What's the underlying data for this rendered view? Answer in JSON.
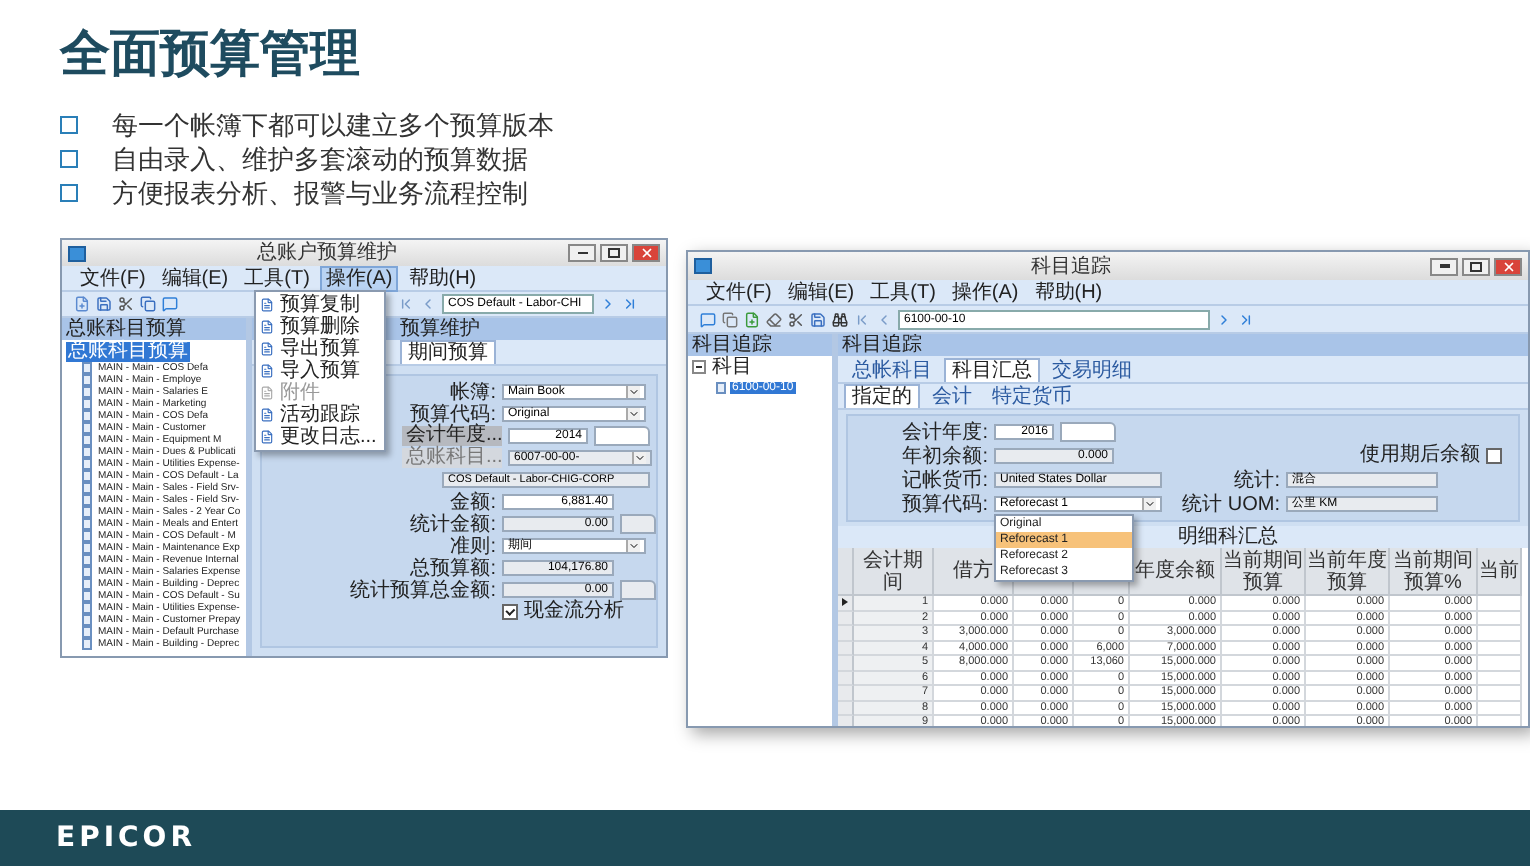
{
  "slide": {
    "title": "全面预算管理",
    "bullets": [
      "每一个帐簿下都可以建立多个预算版本",
      "自由录入、维护多套滚动的预算数据",
      "方便报表分析、报警与业务流程控制"
    ],
    "logo": "EPICOR"
  },
  "left_window": {
    "title": "总账户预算维护",
    "menu": [
      {
        "label": "文件(F)",
        "selected": false
      },
      {
        "label": "编辑(E)",
        "selected": false
      },
      {
        "label": "工具(T)",
        "selected": false
      },
      {
        "label": "操作(A)",
        "selected": true
      },
      {
        "label": "帮助(H)",
        "selected": false
      }
    ],
    "dropdown": [
      {
        "label": "预算复制",
        "disabled": false
      },
      {
        "label": "预算删除",
        "disabled": false
      },
      {
        "label": "导出预算",
        "disabled": false
      },
      {
        "label": "导入预算",
        "disabled": false
      },
      {
        "label": "附件",
        "disabled": true
      },
      {
        "label": "活动跟踪",
        "disabled": false
      },
      {
        "label": "更改日志...",
        "disabled": false
      }
    ],
    "nav_field": "COS Default - Labor-CHI",
    "tree_header": "总账科目预算",
    "tree": {
      "label": "总账科目预算",
      "selected": true,
      "children": [
        {
          "label": "MAIN - Main - COS Defa",
          "selected": false
        },
        {
          "label": "MAIN - Main - Employe",
          "selected": false
        },
        {
          "label": "MAIN - Main - Salaries E",
          "selected": false
        },
        {
          "label": "MAIN - Main - Marketing",
          "selected": false
        },
        {
          "label": "MAIN - Main - COS Defa",
          "selected": false
        },
        {
          "label": "MAIN - Main - Customer",
          "selected": false
        },
        {
          "label": "MAIN - Main - Equipment M",
          "selected": false
        },
        {
          "label": "MAIN - Main - Dues & Publicati",
          "selected": false
        },
        {
          "label": "MAIN - Main - Utilities Expense-",
          "selected": false
        },
        {
          "label": "MAIN - Main - COS Default - La",
          "selected": false
        },
        {
          "label": "MAIN - Main - Sales - Field Srv-",
          "selected": false
        },
        {
          "label": "MAIN - Main - Sales - Field Srv-",
          "selected": false
        },
        {
          "label": "MAIN - Main - Sales - 2 Year Co",
          "selected": false
        },
        {
          "label": "MAIN - Main - Meals and Entert",
          "selected": false
        },
        {
          "label": "MAIN - Main - COS Default - M",
          "selected": false
        },
        {
          "label": "MAIN - Main - Maintenance Exp",
          "selected": false
        },
        {
          "label": "MAIN - Main - Revenue Internal",
          "selected": false
        },
        {
          "label": "MAIN - Main - Salaries Expense",
          "selected": false
        },
        {
          "label": "MAIN - Main - Building - Deprec",
          "selected": false
        },
        {
          "label": "MAIN - Main - COS Default - Su",
          "selected": false
        },
        {
          "label": "MAIN - Main - Utilities Expense-",
          "selected": false
        },
        {
          "label": "MAIN - Main - Customer Prepay",
          "selected": false
        },
        {
          "label": "MAIN - Main - Default Purchase",
          "selected": false
        },
        {
          "label": "MAIN - Main - Building - Deprec",
          "selected": false
        }
      ]
    },
    "panel_header": "预算维护",
    "tabs": [
      {
        "label": "期间预算",
        "selected": true
      }
    ],
    "form": [
      {
        "kind": "select",
        "label": "帐簿:",
        "value": "Main Book"
      },
      {
        "kind": "select",
        "label": "预算代码:",
        "value": "Original"
      },
      {
        "kind": "button",
        "label": "会计年度...",
        "value": "2014"
      },
      {
        "kind": "account",
        "label": "总账科目...",
        "value": "6007-00-00-"
      },
      {
        "kind": "readonly",
        "value": "COS Default - Labor-CHIG-CORP"
      },
      {
        "kind": "input",
        "label": "金额:",
        "value": "6,881.40"
      },
      {
        "kind": "readonly_extra",
        "label": "统计金额:",
        "value": "0.00"
      },
      {
        "kind": "select",
        "label": "准则:",
        "value": "期间"
      },
      {
        "kind": "readonly",
        "label": "总预算额:",
        "value": "104,176.80"
      },
      {
        "kind": "readonly_extra",
        "label": "统计预算总金额:",
        "value": "0.00"
      },
      {
        "kind": "checkbox",
        "label": "现金流分析",
        "checked": true
      }
    ]
  },
  "right_window": {
    "title": "科目追踪",
    "menu": [
      "文件(F)",
      "编辑(E)",
      "工具(T)",
      "操作(A)",
      "帮助(H)"
    ],
    "nav_field": "6100-00-10",
    "tree_header": "科目追踪",
    "tree": {
      "label": "科目",
      "expanded": true,
      "children": [
        {
          "label": "6100-00-10",
          "selected": true
        }
      ]
    },
    "panel_header": "科目追踪",
    "tabs": [
      {
        "label": "总帐科目",
        "selected": false
      },
      {
        "label": "科目汇总",
        "selected": true
      },
      {
        "label": "交易明细",
        "selected": false
      }
    ],
    "subtabs": [
      {
        "label": "指定的",
        "selected": true
      },
      {
        "label": "会计",
        "selected": false
      },
      {
        "label": "特定货币",
        "selected": false
      }
    ],
    "fiscal_year": {
      "label": "会计年度:",
      "value": "2016"
    },
    "opening_balance": {
      "label": "年初余额:",
      "value": "0.000"
    },
    "currency": {
      "label": "记帐货币:",
      "value": "United States Dollar"
    },
    "budget_code": {
      "label": "预算代码:",
      "value": "Reforecast 1"
    },
    "post_balance": {
      "label": "使用期后余额",
      "checked": false
    },
    "statistic": {
      "label": "统计:",
      "value": "混合"
    },
    "uom": {
      "label": "统计 UOM:",
      "value": "公里 KM"
    },
    "dropdown": [
      {
        "label": "Original",
        "selected": false
      },
      {
        "label": "Reforecast 1",
        "selected": true
      },
      {
        "label": "Reforecast 2",
        "selected": false
      },
      {
        "label": "Reforecast 3",
        "selected": false
      }
    ],
    "section_header": "明细科汇总",
    "grid": {
      "columns": [
        "会计期间",
        "借方",
        "",
        "",
        "年度余额",
        "当前期间预算",
        "当前年度预算",
        "当前期间预算%",
        "当前"
      ],
      "rows": [
        {
          "current": true,
          "cells": [
            "1",
            "0.000",
            "0.000",
            "0",
            "0.000",
            "0.000",
            "0.000",
            "0.000"
          ]
        },
        {
          "current": false,
          "cells": [
            "2",
            "0.000",
            "0.000",
            "0",
            "0.000",
            "0.000",
            "0.000",
            "0.000"
          ]
        },
        {
          "current": false,
          "cells": [
            "3",
            "3,000.000",
            "0.000",
            "0",
            "3,000.000",
            "0.000",
            "0.000",
            "0.000"
          ]
        },
        {
          "current": false,
          "cells": [
            "4",
            "4,000.000",
            "0.000",
            "6,000",
            "7,000.000",
            "0.000",
            "0.000",
            "0.000"
          ]
        },
        {
          "current": false,
          "cells": [
            "5",
            "8,000.000",
            "0.000",
            "13,060",
            "15,000.000",
            "0.000",
            "0.000",
            "0.000"
          ]
        },
        {
          "current": false,
          "cells": [
            "6",
            "0.000",
            "0.000",
            "0",
            "15,000.000",
            "0.000",
            "0.000",
            "0.000"
          ]
        },
        {
          "current": false,
          "cells": [
            "7",
            "0.000",
            "0.000",
            "0",
            "15,000.000",
            "0.000",
            "0.000",
            "0.000"
          ]
        },
        {
          "current": false,
          "cells": [
            "8",
            "0.000",
            "0.000",
            "0",
            "15,000.000",
            "0.000",
            "0.000",
            "0.000"
          ]
        },
        {
          "current": false,
          "cells": [
            "9",
            "0.000",
            "0.000",
            "0",
            "15,000.000",
            "0.000",
            "0.000",
            "0.000"
          ]
        }
      ]
    }
  }
}
